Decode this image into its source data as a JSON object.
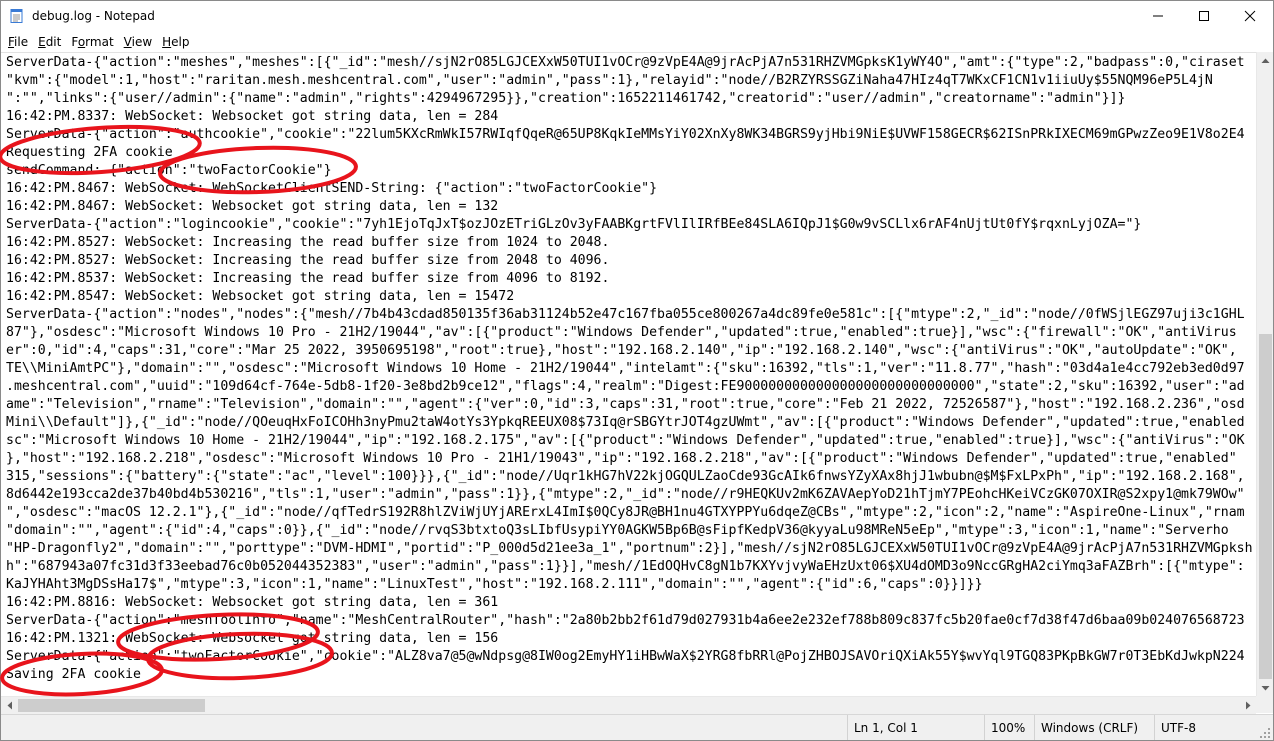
{
  "window": {
    "title": "debug.log - Notepad",
    "icon": "notepad-icon"
  },
  "caption_buttons": {
    "minimize_icon": "minimize-icon",
    "maximize_icon": "maximize-icon",
    "close_icon": "close-icon"
  },
  "menu": {
    "items": [
      {
        "label": "File",
        "accel": "F"
      },
      {
        "label": "Edit",
        "accel": "E"
      },
      {
        "label": "Format",
        "accel": "o"
      },
      {
        "label": "View",
        "accel": "V"
      },
      {
        "label": "Help",
        "accel": "H"
      }
    ]
  },
  "editor": {
    "lines": [
      "ServerData-{\"action\":\"meshes\",\"meshes\":[{\"_id\":\"mesh//sjN2rO85LGJCEXxW50TUI1vOCr@9zVpE4A@9jrAcPjA7n531RHZVMGpksK1yWY4O\",\"amt\":{\"type\":2,\"badpass\":0,\"ciraset",
      "\"kvm\":{\"model\":1,\"host\":\"raritan.mesh.meshcentral.com\",\"user\":\"admin\",\"pass\":1},\"relayid\":\"node//B2RZYRSSGZiNaha47HIz4qT7WKxCF1CN1v1iiuUy$55NQM96eP5L4jN",
      "\":\"\",\"links\":{\"user//admin\":{\"name\":\"admin\",\"rights\":4294967295}},\"creation\":1652211461742,\"creatorid\":\"user//admin\",\"creatorname\":\"admin\"}]}",
      "16:42:PM.8337: WebSocket: Websocket got string data, len = 284",
      "ServerData-{\"action\":\"authcookie\",\"cookie\":\"22lum5KXcRmWkI57RWIqfQqeR@65UP8KqkIeMMsYiY02XnXy8WK34BGRS9yjHbi9NiE$UVWF158GECR$62ISnPRkIXECM69mGPwzZeo9E1V8o2E4",
      "Requesting 2FA cookie",
      "sendCommand: {\"action\":\"twoFactorCookie\"}",
      "16:42:PM.8467: WebSocket: WebSocketClientSEND-String: {\"action\":\"twoFactorCookie\"}",
      "16:42:PM.8467: WebSocket: Websocket got string data, len = 132",
      "ServerData-{\"action\":\"logincookie\",\"cookie\":\"7yh1EjoTqJxT$ozJOzETriGLzOv3yFAABKgrtFVlIlIRfBEe84SLA6IQpJ1$G0w9vSCLlx6rAF4nUjtUt0fY$rqxnLyjOZA=\"}",
      "16:42:PM.8527: WebSocket: Increasing the read buffer size from 1024 to 2048.",
      "16:42:PM.8527: WebSocket: Increasing the read buffer size from 2048 to 4096.",
      "16:42:PM.8537: WebSocket: Increasing the read buffer size from 4096 to 8192.",
      "16:42:PM.8547: WebSocket: Websocket got string data, len = 15472",
      "ServerData-{\"action\":\"nodes\",\"nodes\":{\"mesh//7b4b43cdad850135f36ab31124b52e47c167fba055ce800267a4dc89fe0e581c\":[{\"mtype\":2,\"_id\":\"node//0fWSjlEGZ97uji3c1GHL",
      "87\"},\"osdesc\":\"Microsoft Windows 10 Pro - 21H2/19044\",\"av\":[{\"product\":\"Windows Defender\",\"updated\":true,\"enabled\":true}],\"wsc\":{\"firewall\":\"OK\",\"antiVirus",
      "er\":0,\"id\":4,\"caps\":31,\"core\":\"Mar 25 2022, 3950695198\",\"root\":true},\"host\":\"192.168.2.140\",\"ip\":\"192.168.2.140\",\"wsc\":{\"antiVirus\":\"OK\",\"autoUpdate\":\"OK\",",
      "TE\\\\MiniAmtPC\"},\"domain\":\"\",\"osdesc\":\"Microsoft Windows 10 Home - 21H2/19044\",\"intelamt\":{\"sku\":16392,\"tls\":1,\"ver\":\"11.8.77\",\"hash\":\"03d4a1e4cc792eb3ed0d97",
      ".meshcentral.com\",\"uuid\":\"109d64cf-764e-5db8-1f20-3e8bd2b9ce12\",\"flags\":4,\"realm\":\"Digest:FE900000000000000000000000000000\",\"state\":2,\"sku\":16392,\"user\":\"ad",
      "ame\":\"Television\",\"rname\":\"Television\",\"domain\":\"\",\"agent\":{\"ver\":0,\"id\":3,\"caps\":31,\"root\":true,\"core\":\"Feb 21 2022, 72526587\"},\"host\":\"192.168.2.236\",\"osd",
      "Mini\\\\Default\"]},{\"_id\":\"node//QOeuqHxFoICOHh3nyPmu2taW4otYs3YpkqREEUX08$73Iq@rSBGYtrJOT4gzUWmt\",\"av\":[{\"product\":\"Windows Defender\",\"updated\":true,\"enabled",
      "sc\":\"Microsoft Windows 10 Home - 21H2/19044\",\"ip\":\"192.168.2.175\",\"av\":[{\"product\":\"Windows Defender\",\"updated\":true,\"enabled\":true}],\"wsc\":{\"antiVirus\":\"OK",
      "},\"host\":\"192.168.2.218\",\"osdesc\":\"Microsoft Windows 10 Pro - 21H1/19043\",\"ip\":\"192.168.2.218\",\"av\":[{\"product\":\"Windows Defender\",\"updated\":true,\"enabled\"",
      "315,\"sessions\":{\"battery\":{\"state\":\"ac\",\"level\":100}}},{\"_id\":\"node//Uqr1kHG7hV22kjOGQULZaoCde93GcAIk6fnwsYZyXAx8hjJ1wbubn@$M$FxLPxPh\",\"ip\":\"192.168.2.168\",",
      "8d6442e193cca2de37b40bd4b530216\",\"tls\":1,\"user\":\"admin\",\"pass\":1}},{\"mtype\":2,\"_id\":\"node//r9HEQKUv2mK6ZAVAepYoD21hTjmY7PEohcHKeiVCzGK07OXIR@S2xpy1@mk79WOw\"",
      "\",\"osdesc\":\"macOS 12.2.1\"},{\"_id\":\"node//qfTedrS192R8hlZViWjUYjARErxL4ImI$0QCy8JR@BH1nu4GTXYPPYu6dqeZ@CBs\",\"mtype\":2,\"icon\":2,\"name\":\"AspireOne-Linux\",\"rnam",
      "\"domain\":\"\",\"agent\":{\"id\":4,\"caps\":0}},{\"_id\":\"node//rvqS3btxtoQ3sLIbfUsypiYY0AGKW5Bp6B@sFipfKedpV36@kyyaLu98MReN5eEp\",\"mtype\":3,\"icon\":1,\"name\":\"Serverho",
      "\"HP-Dragonfly2\",\"domain\":\"\",\"porttype\":\"DVM-HDMI\",\"portid\":\"P_000d5d21ee3a_1\",\"portnum\":2}],\"mesh//sjN2rO85LGJCEXxW50TUI1vOCr@9zVpE4A@9jrAcPjA7n531RHZVMGpksh",
      "h\":\"687943a07fc31d3f33eebad76c0b052044352383\",\"user\":\"admin\",\"pass\":1}}],\"mesh//1EdOQHvC8gN1b7KXYvjvyWaEHzUxt06$XU4dOMD3o9NccGRgHA2ciYmq3aFAZBrh\":[{\"mtype\":",
      "KaJYHAht3MgDSsHa17$\",\"mtype\":3,\"icon\":1,\"name\":\"LinuxTest\",\"host\":\"192.168.2.111\",\"domain\":\"\",\"agent\":{\"id\":6,\"caps\":0}}]}}",
      "16:42:PM.8816: WebSocket: Websocket got string data, len = 361",
      "ServerData-{\"action\":\"meshToolInfo\",\"name\":\"MeshCentralRouter\",\"hash\":\"2a80b2bb2f61d79d027931b4a6ee2e232ef788b809c837fc5b20fae0cf7d38f47d6baa09b024076568723",
      "16:42:PM.1321: WebSocket: Websocket got string data, len = 156",
      "ServerData-{\"action\":\"twoFactorCookie\",\"cookie\":\"ALZ8va7@5@wNdpsg@8IW0og2EmyHY1iHBwWaX$2YRG8fbRRl@PojZHBOJSAVOriQXiAk55Y$wvYql9TGQ83PKpBkGW7r0T3EbKdJwkpN224",
      "Saving 2FA cookie"
    ]
  },
  "scrollbars": {
    "up_icon": "scroll-up-arrow-icon",
    "down_icon": "scroll-down-arrow-icon",
    "left_icon": "scroll-left-arrow-icon",
    "right_icon": "scroll-right-arrow-icon"
  },
  "status": {
    "position": "Ln 1, Col 1",
    "zoom": "100%",
    "line_ending": "Windows (CRLF)",
    "encoding": "UTF-8"
  },
  "annotation_color": "#e8141c"
}
